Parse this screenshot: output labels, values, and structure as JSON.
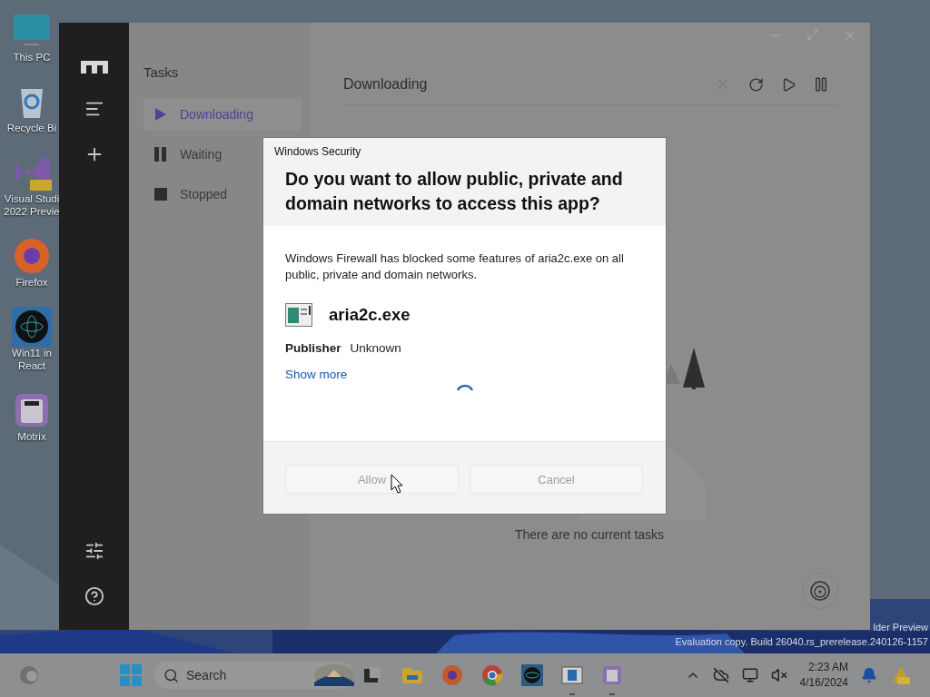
{
  "desktop_icons": [
    {
      "kind": "pc",
      "lines": [
        "This PC"
      ]
    },
    {
      "kind": "recycle",
      "lines": [
        "Recycle Bi"
      ]
    },
    {
      "kind": "vs",
      "lines": [
        "Visual Studi",
        "2022 Previe"
      ]
    },
    {
      "kind": "firefox",
      "lines": [
        "Firefox"
      ]
    },
    {
      "kind": "react",
      "lines": [
        "Win11 in",
        "React"
      ]
    },
    {
      "kind": "motrix",
      "lines": [
        "Motrix"
      ]
    }
  ],
  "app": {
    "tasks_title": "Tasks",
    "task_items": [
      {
        "kind": "play",
        "label": "Downloading",
        "selected": true
      },
      {
        "kind": "pause",
        "label": "Waiting",
        "selected": false
      },
      {
        "kind": "stop",
        "label": "Stopped",
        "selected": false
      }
    ],
    "main_title": "Downloading",
    "empty_text": "There are no current tasks"
  },
  "dialog": {
    "caption": "Windows Security",
    "heading": "Do you want to allow public, private and domain networks to access this app?",
    "message": "Windows Firewall has blocked some features of aria2c.exe on all public, private and domain networks.",
    "app_name": "aria2c.exe",
    "publisher_label": "Publisher",
    "publisher": "Unknown",
    "link": "Show more",
    "buttons": [
      {
        "label": "Allow",
        "disabled": true
      },
      {
        "label": "Cancel",
        "disabled": true
      }
    ]
  },
  "watermark": [
    "lder Preview",
    "Evaluation copy. Build 26040.rs_prerelease.240126-1157"
  ],
  "taskbar": {
    "search_placeholder": "Search",
    "apps": [
      {
        "kind": "taskview",
        "running": false
      },
      {
        "kind": "explorer",
        "running": false
      },
      {
        "kind": "firefox",
        "running": false
      },
      {
        "kind": "chrome",
        "running": false
      },
      {
        "kind": "react",
        "running": false
      },
      {
        "kind": "window",
        "running": true
      },
      {
        "kind": "motrix",
        "running": true
      }
    ],
    "time": "2:23 AM",
    "date": "4/16/2024"
  }
}
